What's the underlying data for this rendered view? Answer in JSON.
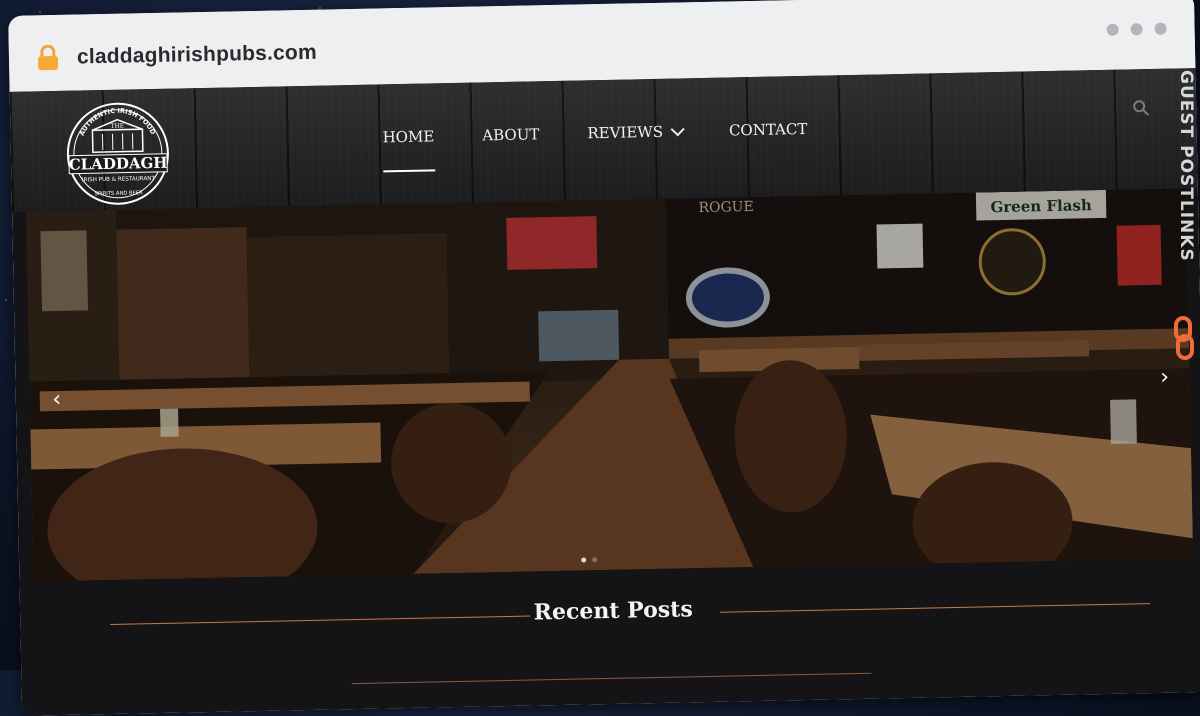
{
  "browser": {
    "url": "claddaghirishpubs.com",
    "icons": {
      "lock": "lock-icon",
      "window_dots": "window-dots"
    }
  },
  "header": {
    "logo": {
      "lines": [
        "AUTHENTIC IRISH FOOD",
        "THE",
        "CLADDAGH",
        "IRISH PUB & RESTAURANT",
        "SPIRITS AND BEER"
      ]
    },
    "nav": [
      {
        "label": "HOME",
        "active": true
      },
      {
        "label": "ABOUT",
        "active": false
      },
      {
        "label": "REVIEWS",
        "active": false,
        "has_dropdown": true
      },
      {
        "label": "CONTACT",
        "active": false
      }
    ],
    "search_icon": "search-icon"
  },
  "hero": {
    "signs": [
      "Green Flash",
      "ROGUE"
    ],
    "prev_icon": "chevron-left-icon",
    "next_icon": "chevron-right-icon",
    "slides_count": 2,
    "active_slide": 1
  },
  "recent_posts": {
    "title": "Recent Posts"
  },
  "watermark": {
    "text": "GUEST POSTLINKS",
    "icon": "link-icon",
    "color": "#f06a3a"
  },
  "colors": {
    "accent_rule": "#c8794a",
    "page_bg": "#141416"
  }
}
